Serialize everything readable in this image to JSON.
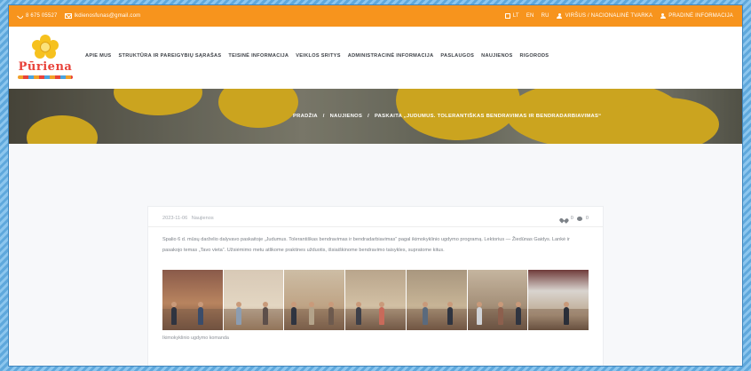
{
  "topbar": {
    "phone": "8 675 05527",
    "email": "lkdienosfunas@gmail.com",
    "lang_lt": "LT",
    "lang_en": "EN",
    "lang_ru": "RU",
    "link_1": "VIRŠUS / NACIONALINĖ TVARKA",
    "link_2": "PRADINĖ INFORMACIJA"
  },
  "logo": {
    "text": "Pūriena"
  },
  "nav": [
    "APIE MUS",
    "STRUKTŪRA IR PAREIGYBIŲ SĄRAŠAS",
    "TEISINĖ INFORMACIJA",
    "VEIKLOS SRITYS",
    "ADMINISTRACINĖ INFORMACIJA",
    "PASLAUGOS",
    "NAUJIENOS",
    "RIGORODS"
  ],
  "hero": {
    "crumb_home": "PRADŽIA",
    "crumb_sep1": "/",
    "crumb_news": "NAUJIENOS",
    "crumb_sep2": "/",
    "crumb_current": "PASKAITA „JUDUMUS. TOLERANTIŠKAS BENDRAVIMAS IR BENDRADARBIAVIMAS“"
  },
  "post": {
    "date": "2023-11-06",
    "category": "Naujienos",
    "likes": "0",
    "comments": "0",
    "text": "Spalio 6 d. mūsų darželio dalyvavo paskaitoje „Judumus. Tolerantiškas bendravimas ir bendradarbiavimas“ pagal ikimokyklinio ugdymo programą. Lektorius — Žiedūnas Gaidys. Lankė ir pasakojo temas „Tavo vieta“. Užsiėmimo metu atlikome praktines užduotis, išsiaiškinome bendravimo taisykles, supratome kitus.",
    "caption": "Ikimokyklinio ugdymo komanda"
  },
  "colors": {
    "accent": "#f7941d",
    "logo_text": "#e8423a"
  }
}
